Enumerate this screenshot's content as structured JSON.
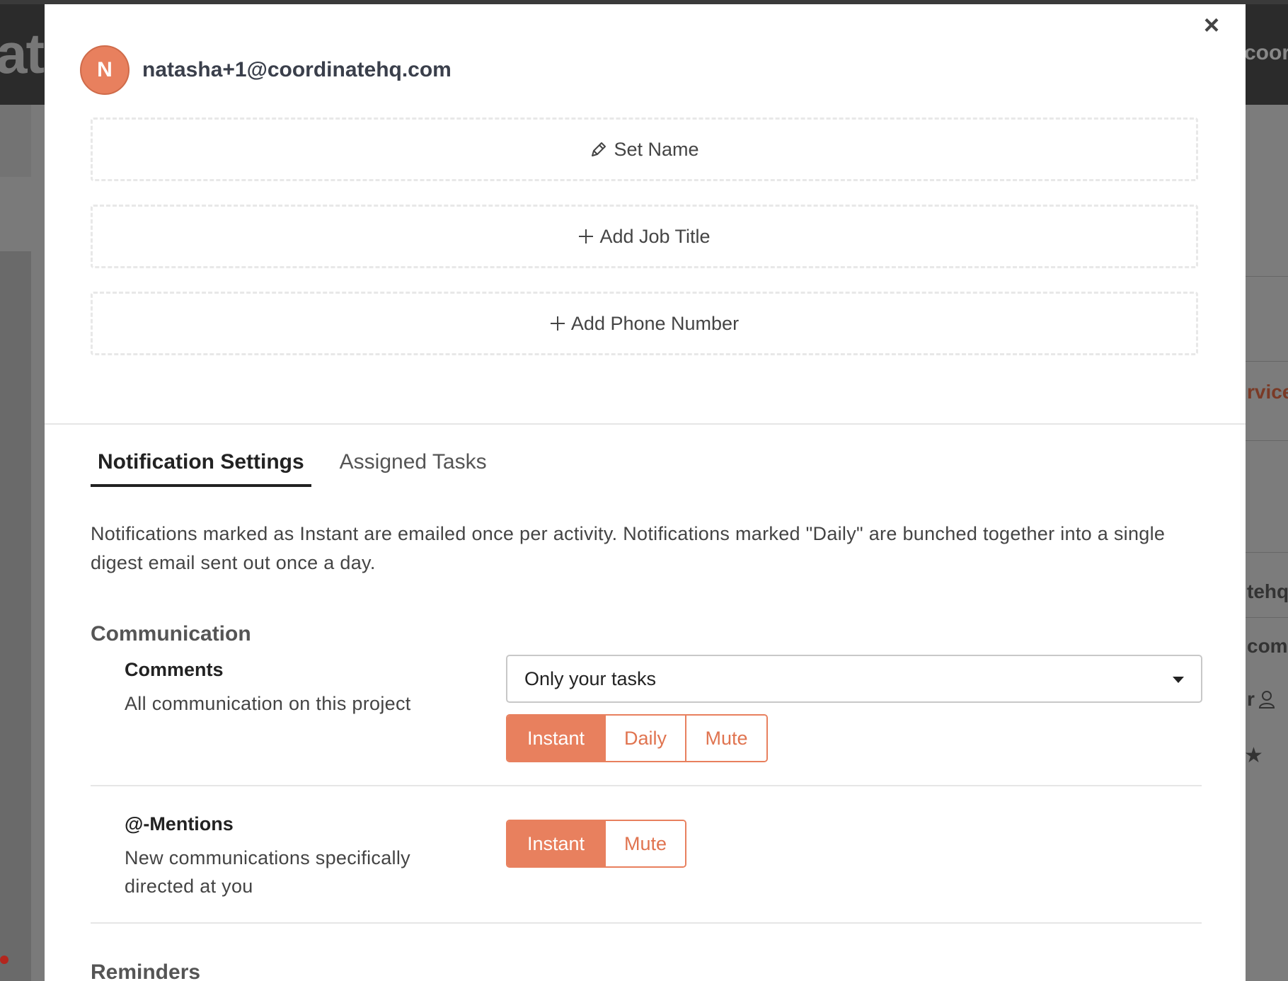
{
  "background": {
    "logo_fragment": "ato",
    "right_top_fragment": "coord",
    "right_fragments": [
      "rvice",
      "tehq.",
      "com",
      "r"
    ],
    "accent_color": "#7a3a26"
  },
  "modal": {
    "close_icon": "close-icon",
    "user": {
      "avatar_initial": "N",
      "email": "natasha+1@coordinatehq.com",
      "avatar_color": "#e8805e"
    },
    "profile_fields": {
      "set_name": "Set Name",
      "add_job_title": "Add Job Title",
      "add_phone_number": "Add Phone Number"
    },
    "tabs": [
      {
        "label": "Notification Settings",
        "active": true
      },
      {
        "label": "Assigned Tasks",
        "active": false
      }
    ],
    "intro": "Notifications marked as Instant are emailed once per activity. Notifications marked \"Daily\" are bunched together into a single digest email sent out once a day.",
    "sections": {
      "communication": {
        "title": "Communication",
        "comments": {
          "label": "Comments",
          "description": "All communication on this project",
          "scope_value": "Only your tasks",
          "options": [
            "Instant",
            "Daily",
            "Mute"
          ],
          "selected": "Instant"
        },
        "mentions": {
          "label": "@-Mentions",
          "description": "New communications specifically directed at you",
          "options": [
            "Instant",
            "Mute"
          ],
          "selected": "Instant"
        }
      },
      "reminders": {
        "title": "Reminders"
      }
    }
  }
}
